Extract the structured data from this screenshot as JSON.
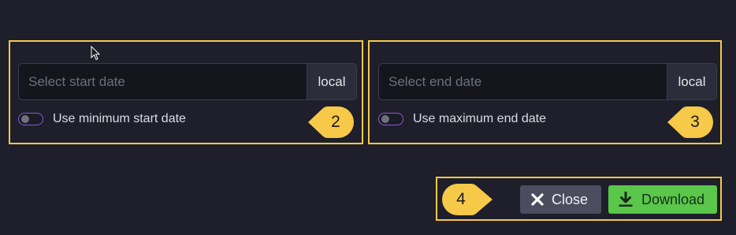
{
  "start": {
    "placeholder": "Select start date",
    "value": "",
    "timezone": "local",
    "toggle_label": "Use minimum start date",
    "toggle_on": false
  },
  "end": {
    "placeholder": "Select end date",
    "value": "",
    "timezone": "local",
    "toggle_label": "Use maximum end date",
    "toggle_on": false
  },
  "actions": {
    "close_label": "Close",
    "download_label": "Download"
  },
  "callouts": {
    "start_number": "2",
    "end_number": "3",
    "actions_number": "4"
  },
  "colors": {
    "background": "#1e1f2b",
    "highlight": "#f7c948",
    "toggle_border": "#8a5bd4",
    "download": "#5ac64a",
    "close": "#4b4c5e"
  },
  "icons": {
    "close": "x-icon",
    "download": "download-icon",
    "cursor": "mouse-pointer-icon"
  }
}
